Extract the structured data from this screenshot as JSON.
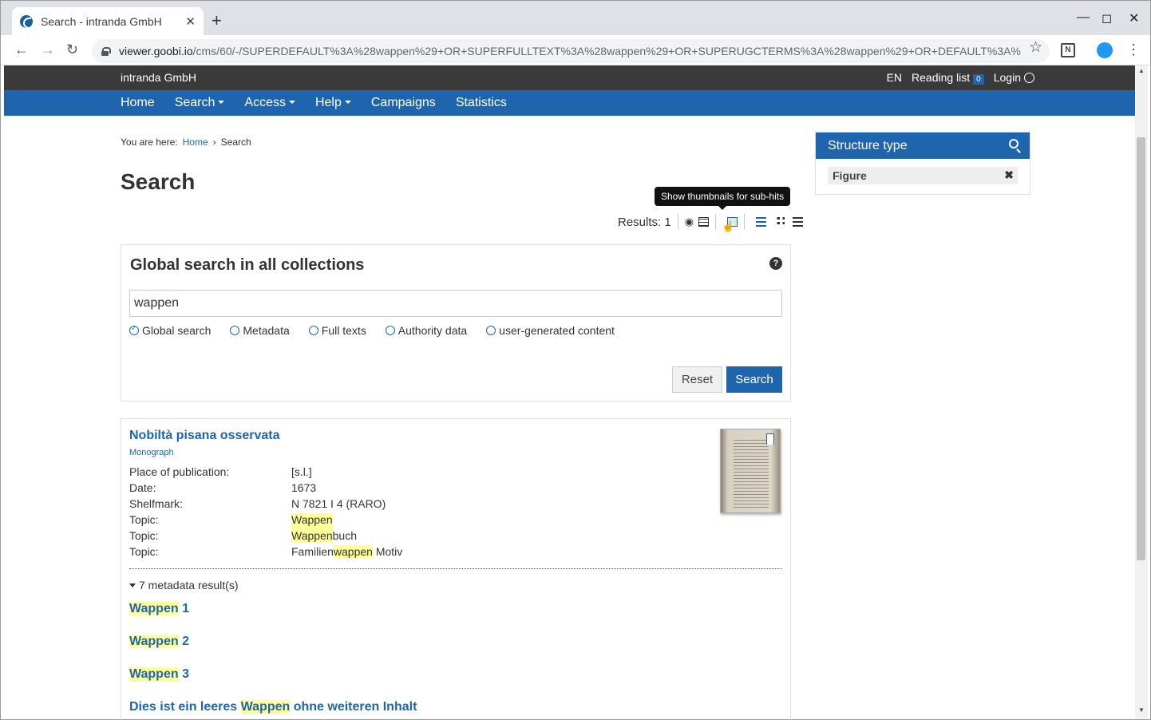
{
  "browser": {
    "tab_title": "Search - intranda GmbH",
    "url_host": "viewer.goobi.io",
    "url_path": "/cms/60/-/SUPERDEFAULT%3A%28wappen%29+OR+SUPERFULLTEXT%3A%28wappen%29+OR+SUPERUGCTERMS%3A%28wappen%29+OR+DEFAULT%3A%28wapp..."
  },
  "header": {
    "brand": "intranda GmbH",
    "lang": "EN",
    "reading_list": "Reading list",
    "reading_count": "0",
    "login": "Login"
  },
  "nav": {
    "home": "Home",
    "search": "Search",
    "access": "Access",
    "help": "Help",
    "campaigns": "Campaigns",
    "statistics": "Statistics"
  },
  "breadcrumb": {
    "prefix": "You are here:",
    "home": "Home",
    "sep": "›",
    "current": "Search"
  },
  "page_title": "Search",
  "tooltip": "Show thumbnails for sub-hits",
  "results_label": "Results: 1",
  "search_panel": {
    "title": "Global search in all collections",
    "query": "wappen",
    "options": [
      "Global search",
      "Metadata",
      "Full texts",
      "Authority data",
      "user-generated content"
    ],
    "reset": "Reset",
    "search": "Search"
  },
  "result": {
    "title": "Nobiltà pisana osservata",
    "type": "Monograph",
    "place_label": "Place of publication:",
    "place": "[s.l.]",
    "date_label": "Date:",
    "date": "1673",
    "shelf_label": "Shelfmark:",
    "shelf": "N 7821 I 4 (RARO)",
    "topic_label": "Topic:",
    "topic1": "Wappen",
    "topic2_hl": "Wappen",
    "topic2_rest": "buch",
    "topic3_pre": "Familien",
    "topic3_hl": "wappen",
    "topic3_post": " Motiv",
    "metadata_results": "7 metadata result(s)",
    "sub1_hl": "Wappen",
    "sub1_rest": " 1",
    "sub2_hl": "Wappen",
    "sub2_rest": " 2",
    "sub3_hl": "Wappen",
    "sub3_rest": " 3",
    "sub4_pre": "Dies ist ein leeres ",
    "sub4_hl": "Wappen",
    "sub4_post": " ohne weiteren Inhalt"
  },
  "sidebar": {
    "title": "Structure type",
    "filter": "Figure"
  }
}
